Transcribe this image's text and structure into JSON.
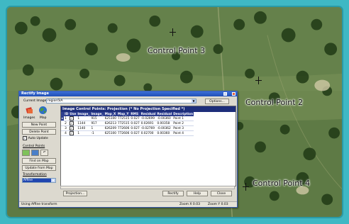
{
  "map": {
    "control_points": [
      {
        "label": "Control Point 3"
      },
      {
        "label": "Control Point 2"
      },
      {
        "label": "Control Point 4"
      }
    ]
  },
  "dialog": {
    "title": "Rectify Image",
    "current_image_label": "Current Image",
    "current_image_value": "region5IA",
    "options_button": "Options...",
    "images_label": "Images",
    "map_label": "Map",
    "new_point_button": "New Point",
    "delete_point_button": "Delete Point",
    "auto_update_label": "Auto Update",
    "control_points_label": "Control Points",
    "find_on_map_button": "Find on Map",
    "update_from_map_button": "Update from Map",
    "transformation_label": "Transformation",
    "transformation_value": "Affine",
    "projection_button": "Projection...",
    "rectify_button": "Rectify",
    "help_button": "Help",
    "close_button": "Close",
    "grid_title": "Image Control Points: Projection (* No Projection Specified *)",
    "columns": [
      "ID",
      "Use",
      "Image_",
      "Image_",
      "Map_X",
      "Map_Y",
      "RMS",
      "Residual",
      "Residual",
      "Description"
    ],
    "rows": [
      {
        "id": "1",
        "image_x": "1",
        "image_y": "915",
        "map_x": "625100",
        "map_y": "772515",
        "rms": "0.027",
        "res_x": "-0.02699",
        "res_y": "-0.00360",
        "desc": "Point 1"
      },
      {
        "id": "2",
        "image_x": "1144",
        "image_y": "917",
        "map_x": "626213",
        "map_y": "772515",
        "rms": "0.027",
        "res_x": "0.02691",
        "res_y": "0.00358",
        "desc": "Point 2"
      },
      {
        "id": "3",
        "image_x": "1140",
        "image_y": "1",
        "map_x": "626209",
        "map_y": "772606",
        "rms": "0.027",
        "res_x": "-0.02769",
        "res_y": "-0.00362",
        "desc": "Point 3"
      },
      {
        "id": "4",
        "image_x": "1",
        "image_y": "-1",
        "map_x": "625100",
        "map_y": "772606",
        "rms": "0.027",
        "res_x": "0.02700",
        "res_y": "0.00360",
        "desc": "Point 4"
      }
    ],
    "zoom_left": "Zoom X 0.03",
    "zoom_right": "Zoom Y 0.03",
    "status": "Using Affine transform"
  },
  "colors": {
    "teal_border": "#3fb8c4",
    "dialog_title": "#2a5bd0",
    "grid_header": "#1d2e7a"
  }
}
